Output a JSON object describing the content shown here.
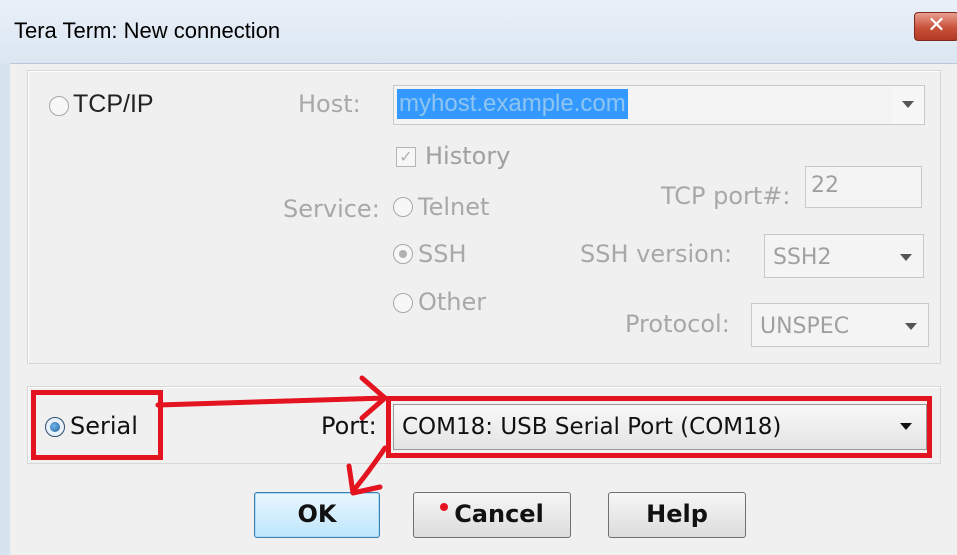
{
  "window": {
    "title": "Tera Term: New connection",
    "close_glyph": "✕"
  },
  "tcpip": {
    "label": "TCP/IP",
    "host_label": "Host:",
    "host_value": "myhost.example.com",
    "history_label": "History",
    "service_label": "Service:",
    "telnet_label": "Telnet",
    "ssh_label": "SSH",
    "other_label": "Other",
    "tcp_port_label": "TCP port#:",
    "tcp_port_value": "22",
    "ssh_version_label": "SSH version:",
    "ssh_version_value": "SSH2",
    "protocol_label": "Protocol:",
    "protocol_value": "UNSPEC"
  },
  "serial": {
    "label": "Serial",
    "port_label": "Port:",
    "port_value": "COM18: USB Serial Port (COM18)"
  },
  "buttons": {
    "ok": "OK",
    "cancel": "Cancel",
    "help": "Help"
  },
  "annotation": {
    "color": "#e3131f"
  }
}
